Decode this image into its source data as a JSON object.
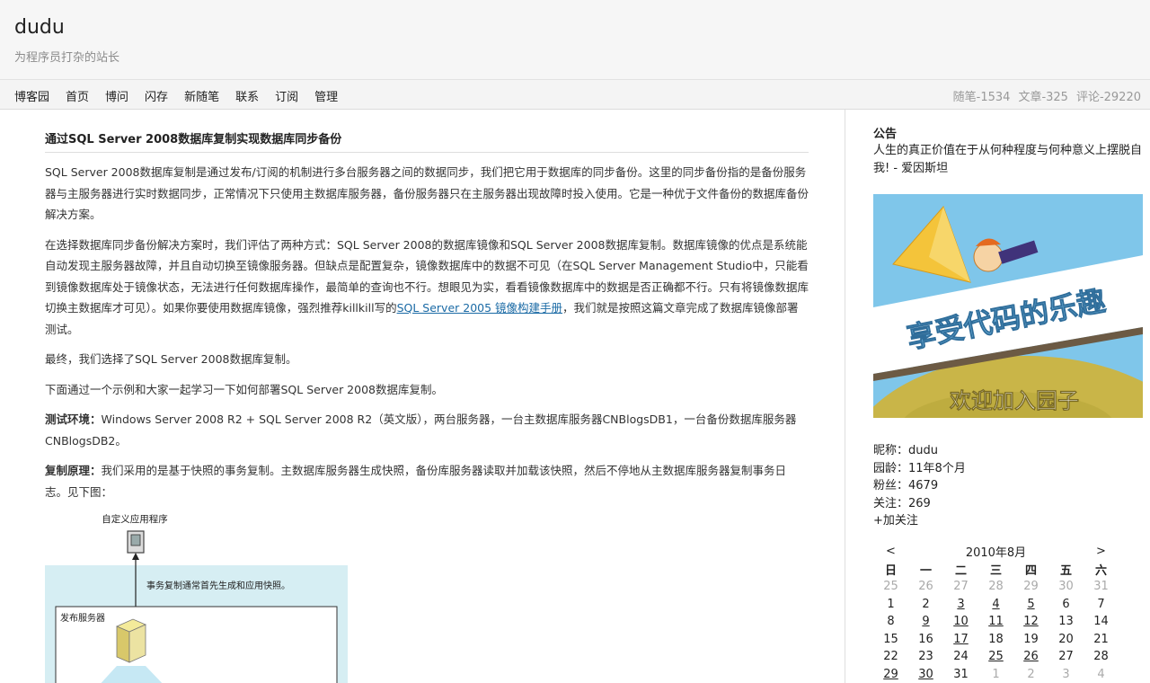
{
  "site": {
    "title": "dudu",
    "subtitle": "为程序员打杂的站长"
  },
  "nav": {
    "links": [
      "博客园",
      "首页",
      "博问",
      "闪存",
      "新随笔",
      "联系",
      "订阅",
      "管理"
    ],
    "stats": [
      "随笔-1534",
      "文章-325",
      "评论-29220"
    ]
  },
  "post": {
    "title": "通过SQL Server 2008数据库复制实现数据库同步备份",
    "p1": "SQL Server 2008数据库复制是通过发布/订阅的机制进行多台服务器之间的数据同步，我们把它用于数据库的同步备份。这里的同步备份指的是备份服务器与主服务器进行实时数据同步，正常情况下只使用主数据库服务器，备份服务器只在主服务器出现故障时投入使用。它是一种优于文件备份的数据库备份解决方案。",
    "p2_before": "在选择数据库同步备份解决方案时，我们评估了两种方式：SQL Server 2008的数据库镜像和SQL Server 2008数据库复制。数据库镜像的优点是系统能自动发现主服务器故障，并且自动切换至镜像服务器。但缺点是配置复杂，镜像数据库中的数据不可见（在SQL Server Management Studio中，只能看到镜像数据库处于镜像状态，无法进行任何数据库操作，最简单的查询也不行。想眼见为实，看看镜像数据库中的数据是否正确都不行。只有将镜像数据库切换主数据库才可见）。如果你要使用数据库镜像，强烈推荐killkill写的",
    "p2_link": "SQL Server 2005 镜像构建手册",
    "p2_after": "，我们就是按照这篇文章完成了数据库镜像部署测试。",
    "p3": "最终，我们选择了SQL Server 2008数据库复制。",
    "p4": "下面通过一个示例和大家一起学习一下如何部署SQL Server 2008数据库复制。",
    "p5_label": "测试环境：",
    "p5_text": "Windows Server 2008 R2 + SQL Server 2008 R2（英文版），两台服务器，一台主数据库服务器CNBlogsDB1，一台备份数据库服务器CNBlogsDB2。",
    "p6_label": "复制原理：",
    "p6_text": "我们采用的是基于快照的事务复制。主数据库服务器生成快照，备份库服务器读取并加载该快照，然后不停地从主数据库服务器复制事务日志。见下图：",
    "diagram": {
      "app_label": "自定义应用程序",
      "note": "事务复制通常首先生成和应用快照。",
      "publisher_label": "发布服务器"
    }
  },
  "sidebar": {
    "notice_title": "公告",
    "notice_text": "人生的真正价值在于从何种程度与何种意义上摆脱自我! - 爱因斯坦",
    "banner": {
      "slogan": "享受代码的乐趣",
      "welcome": "欢迎加入园子"
    },
    "profile": {
      "nickname": "昵称：dudu",
      "age": "园龄：11年8个月",
      "fans": "粉丝：4679",
      "following": "关注：269",
      "follow_link": "+加关注"
    },
    "calendar": {
      "prev": "<",
      "month": "2010年8月",
      "next": ">",
      "weekdays": [
        "日",
        "一",
        "二",
        "三",
        "四",
        "五",
        "六"
      ],
      "weeks": [
        [
          {
            "d": "25",
            "o": 1
          },
          {
            "d": "26",
            "o": 1
          },
          {
            "d": "27",
            "o": 1
          },
          {
            "d": "28",
            "o": 1
          },
          {
            "d": "29",
            "o": 1
          },
          {
            "d": "30",
            "o": 1
          },
          {
            "d": "31",
            "o": 1
          }
        ],
        [
          {
            "d": "1"
          },
          {
            "d": "2"
          },
          {
            "d": "3",
            "l": 1
          },
          {
            "d": "4",
            "l": 1
          },
          {
            "d": "5",
            "l": 1
          },
          {
            "d": "6"
          },
          {
            "d": "7"
          }
        ],
        [
          {
            "d": "8"
          },
          {
            "d": "9",
            "l": 1
          },
          {
            "d": "10",
            "l": 1
          },
          {
            "d": "11",
            "l": 1
          },
          {
            "d": "12",
            "l": 1
          },
          {
            "d": "13"
          },
          {
            "d": "14"
          }
        ],
        [
          {
            "d": "15"
          },
          {
            "d": "16"
          },
          {
            "d": "17",
            "l": 1
          },
          {
            "d": "18"
          },
          {
            "d": "19"
          },
          {
            "d": "20"
          },
          {
            "d": "21"
          }
        ],
        [
          {
            "d": "22"
          },
          {
            "d": "23"
          },
          {
            "d": "24"
          },
          {
            "d": "25",
            "l": 1
          },
          {
            "d": "26",
            "l": 1
          },
          {
            "d": "27"
          },
          {
            "d": "28"
          }
        ],
        [
          {
            "d": "29",
            "l": 1
          },
          {
            "d": "30",
            "l": 1
          },
          {
            "d": "31"
          },
          {
            "d": "1",
            "o": 1
          },
          {
            "d": "2",
            "o": 1
          },
          {
            "d": "3",
            "o": 1
          },
          {
            "d": "4",
            "o": 1
          }
        ]
      ]
    }
  }
}
